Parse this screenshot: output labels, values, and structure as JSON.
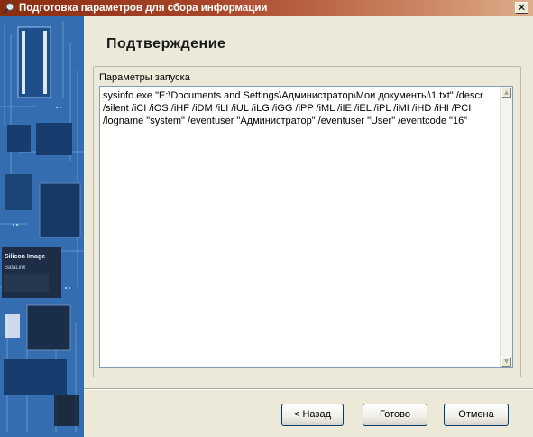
{
  "window": {
    "title": "Подготовка параметров для сбора информации",
    "close_glyph": "✕"
  },
  "page": {
    "title": "Подтверждение"
  },
  "params": {
    "label": "Параметры запуска",
    "value": "sysinfo.exe \"E:\\Documents and Settings\\Администратор\\Мои документы\\1.txt\" /descr /silent /iCI /iOS /iHF /iDM /iLI /iUL /iLG /iGG /iPP /iML /iIE /iEL /iPL /iMI /iHD /iHI /PCI /logname \"system\" /eventuser \"Администратор\" /eventuser \"User\" /eventcode \"16\""
  },
  "scrollbar": {
    "up_glyph": "▲",
    "down_glyph": "▼"
  },
  "buttons": {
    "back": "< Назад",
    "done": "Готово",
    "cancel": "Отмена"
  },
  "icons": {
    "title_icon": "magnifier-icon",
    "side_image": "circuit-board-image"
  },
  "colors": {
    "titlebar_start": "#8a2c10",
    "titlebar_end": "#dcae8a",
    "window_bg": "#ece9d8",
    "board_blue": "#2f66a8"
  },
  "side_image_text": {
    "chip1": "Silicon Image",
    "chip2": "SataLink"
  }
}
